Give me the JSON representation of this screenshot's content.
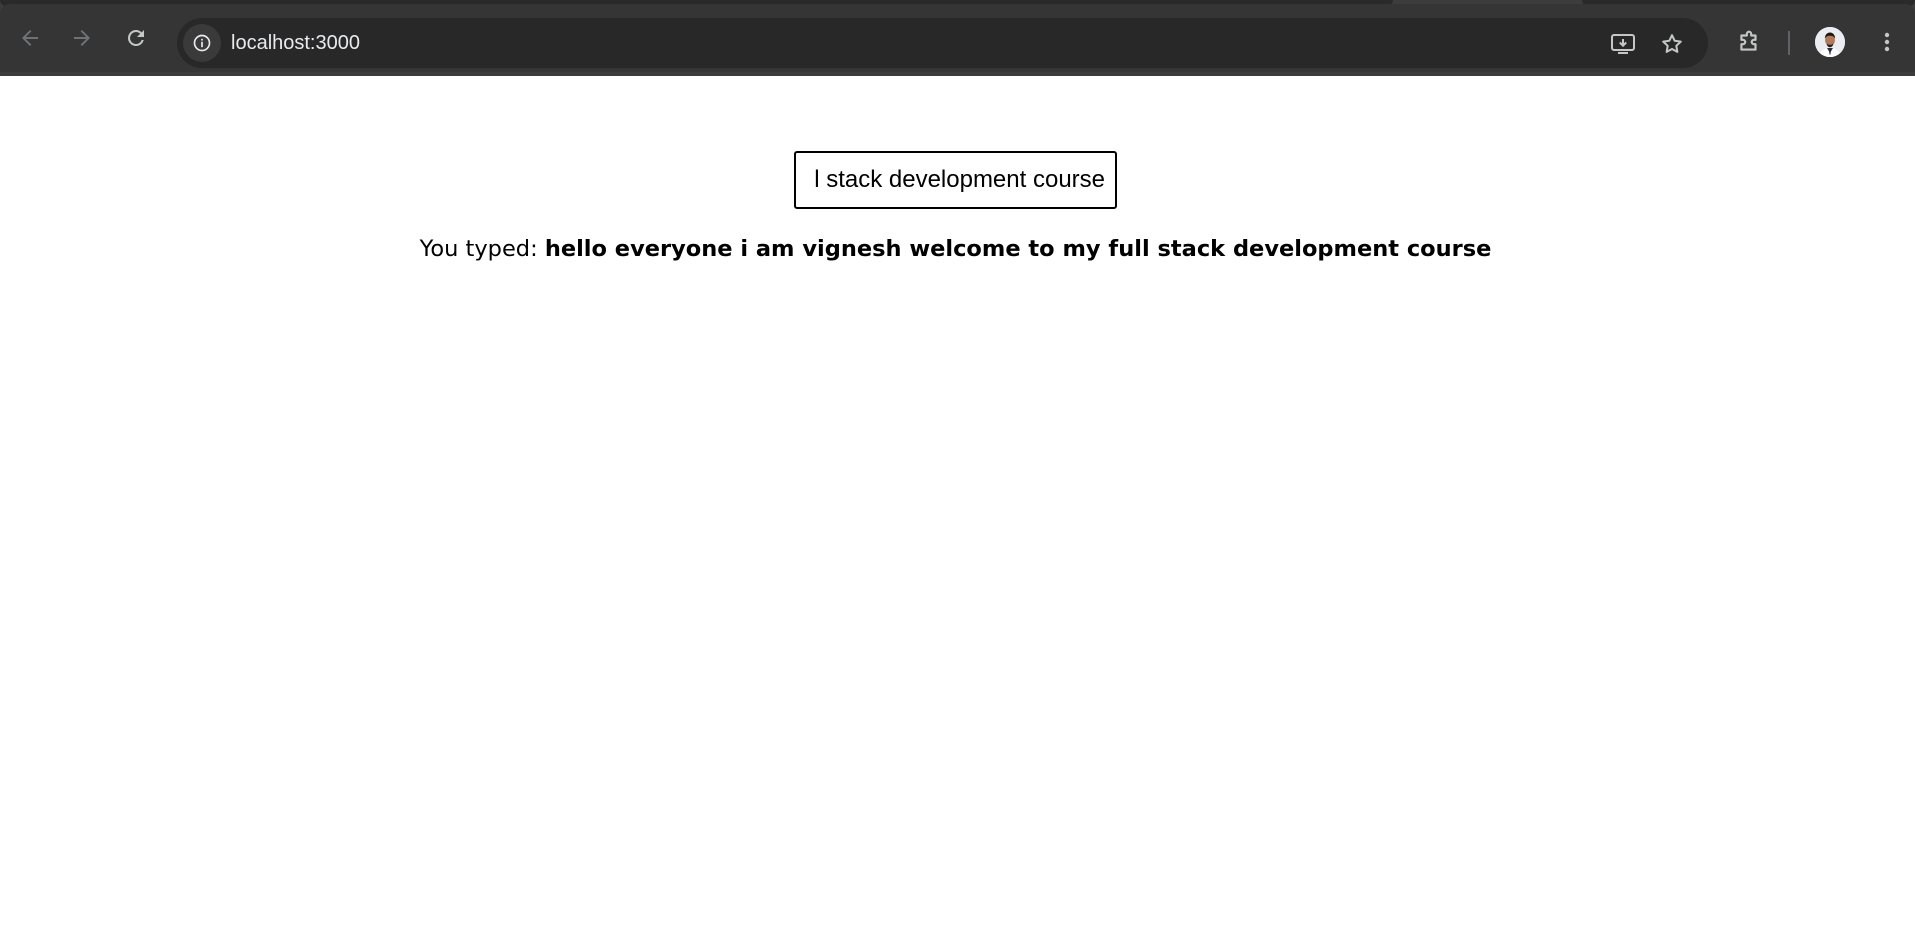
{
  "browser": {
    "url": "localhost:3000",
    "icons": {
      "back": "arrow-left-icon",
      "forward": "arrow-right-icon",
      "reload": "reload-icon",
      "site_info": "info-icon",
      "install": "install-app-icon",
      "bookmark": "star-icon",
      "extensions": "puzzle-icon",
      "profile": "avatar",
      "menu": "kebab-menu-icon"
    },
    "colors": {
      "frame": "#3c3c3c",
      "toolbar": "#353535",
      "omnibox": "#282828",
      "icon": "#c4c7c5"
    }
  },
  "page": {
    "input_value": "l stack development course",
    "typed_label": "You typed: ",
    "typed_value": "hello everyone i am vignesh welcome to my full stack development course"
  }
}
